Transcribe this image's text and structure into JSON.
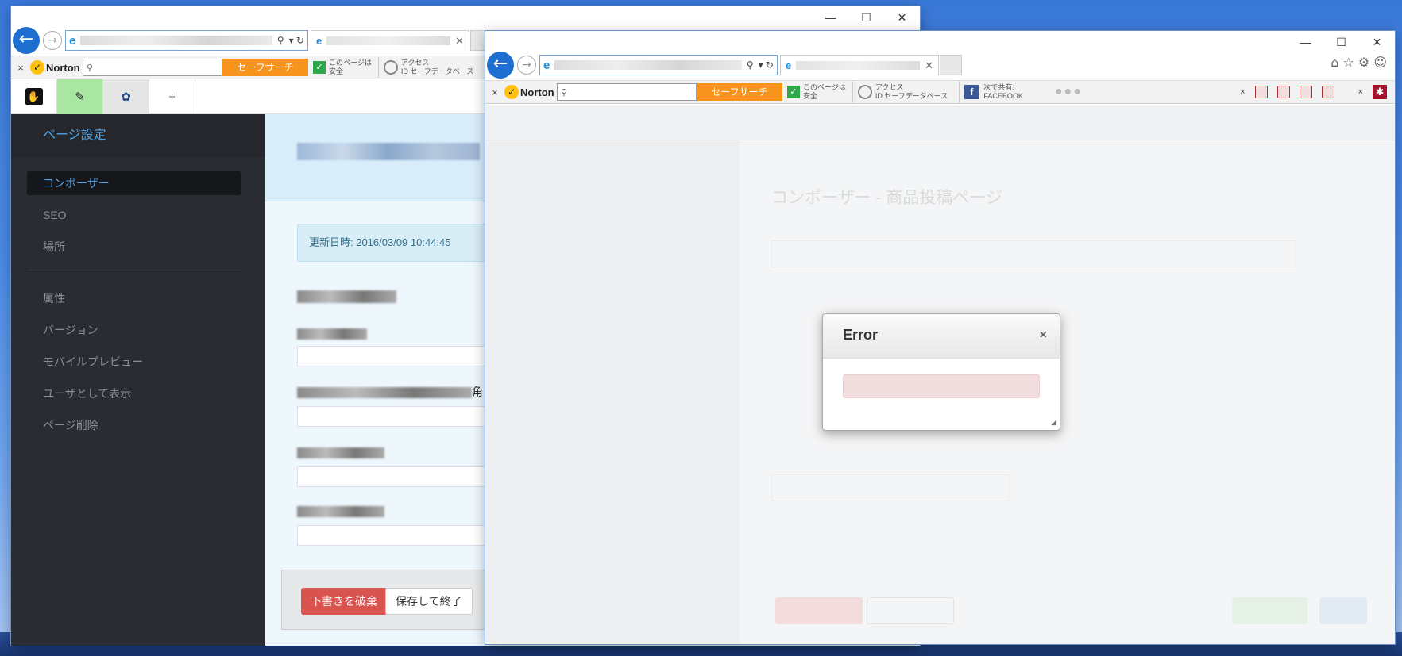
{
  "window1": {
    "controls": [
      "—",
      "☐",
      "✕"
    ],
    "nav": {
      "back": "←",
      "forward": "→"
    },
    "address": {
      "search_glyph": "⚲",
      "ctrl": "▾ ↻"
    },
    "norton": {
      "close": "×",
      "brand": "Norton",
      "search_button": "セーフサーチ",
      "safe_line1": "このページは",
      "safe_line2": "安全",
      "id_line1": "アクセス",
      "id_line2": "ID セーフデータベース"
    },
    "toolbar": {
      "logo": "✋",
      "edit": "✎",
      "settings": "✿",
      "add": "+"
    },
    "sidebar": {
      "title": "ページ設定",
      "items_top": [
        {
          "label": "コンポーザー",
          "active": true
        },
        {
          "label": "SEO",
          "active": false
        },
        {
          "label": "場所",
          "active": false
        }
      ],
      "items_bottom": [
        {
          "label": "属性"
        },
        {
          "label": "バージョン"
        },
        {
          "label": "モバイルプレビュー"
        },
        {
          "label": "ユーザとして表示"
        },
        {
          "label": "ページ削除"
        }
      ]
    },
    "main": {
      "updated": "更新日時: 2016/03/09 10:44:45",
      "kaku": "角",
      "discard_button": "下書きを破棄",
      "save_exit_button": "保存して終了"
    }
  },
  "window2": {
    "controls": [
      "—",
      "☐",
      "✕"
    ],
    "nav": {
      "back": "←",
      "forward": "→",
      "right_icons": "⌂ ☆ ⚙ ☺"
    },
    "address": {
      "search_glyph": "⚲",
      "ctrl": "▾ ↻"
    },
    "norton": {
      "close": "×",
      "brand": "Norton",
      "search_button": "セーフサーチ",
      "safe_line1": "このページは",
      "safe_line2": "安全",
      "id_line1": "アクセス",
      "id_line2": "ID セーフデータベース",
      "share_line1": "次で共有:",
      "share_line2": "FACEBOOK",
      "more": "●●●",
      "ext_close": "×",
      "ext_close2": "×",
      "ext_icon": "✱"
    },
    "background": {
      "title": "コンポーザー - 商品投稿ページ"
    },
    "modal": {
      "title": "Error",
      "close": "×",
      "grip": "◢"
    }
  }
}
